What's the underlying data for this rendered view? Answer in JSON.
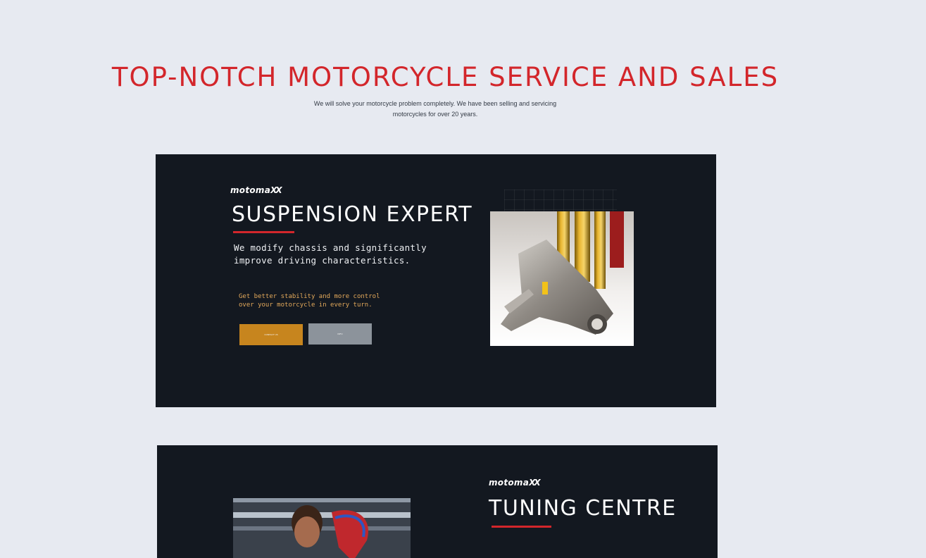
{
  "hero": {
    "title": "TOP-NOTCH MOTORCYCLE SERVICE AND SALES",
    "subtitle_line1": "We will solve your motorcycle problem completely. We have been selling and servicing",
    "subtitle_line2": "motorcycles for over 20 years."
  },
  "brand": {
    "logo_text": "motoma",
    "logo_suffix": "XX"
  },
  "panels": [
    {
      "title": "SUSPENSION EXPERT",
      "desc_line1": "We modify chassis and significantly",
      "desc_line2": "improve driving characteristics.",
      "note_line1": "Get better stability and more control",
      "note_line2": "over your motorcycle in every turn.",
      "primary_label": "CONTACT US",
      "secondary_label": "INFO",
      "image_icon": "suspension-parts-photo"
    },
    {
      "title": "TUNING CENTRE",
      "image_icon": "mechanic-photo"
    }
  ],
  "colors": {
    "page_bg": "#e7eaf1",
    "panel_bg": "#131820",
    "accent_red": "#d3262b",
    "accent_orange": "#c7851e",
    "button_grey": "#8c939b"
  }
}
